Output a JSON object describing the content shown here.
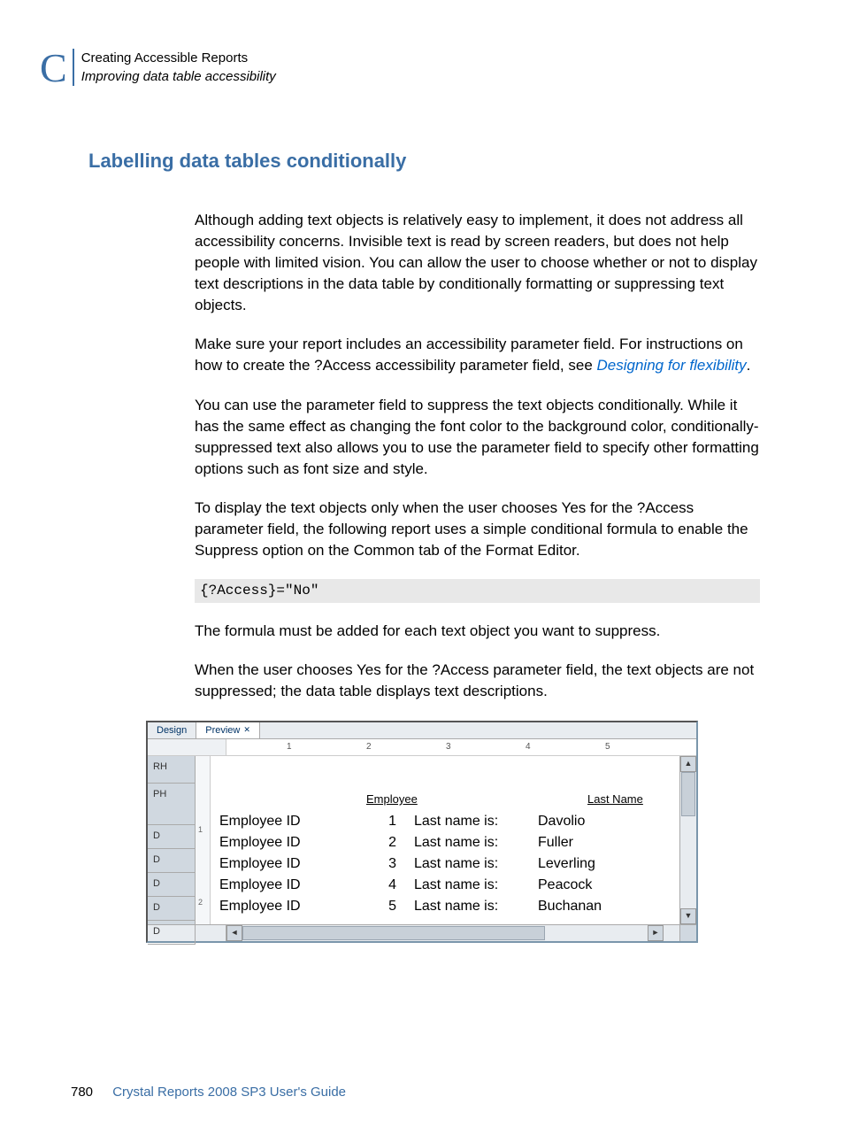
{
  "header": {
    "appendix_letter": "C",
    "line1": "Creating Accessible Reports",
    "line2": "Improving data table accessibility"
  },
  "section_heading": "Labelling data tables conditionally",
  "paragraphs": {
    "p1": "Although adding text objects is relatively easy to implement, it does not address all accessibility concerns. Invisible text is read by screen readers, but does not help people with limited vision. You can allow the user to choose whether or not to display text descriptions in the data table by conditionally formatting or suppressing text objects.",
    "p2a": "Make sure your report includes an accessibility parameter field. For instructions on how to create the ?Access accessibility parameter field, see ",
    "p2_link": "Designing for flexibility",
    "p2b": ".",
    "p3": "You can use the parameter field to suppress the text objects conditionally. While it has the same effect as changing the font color to the background color, conditionally-suppressed text also allows you to use the parameter field to specify other formatting options such as font size and style.",
    "p4": "To display the text objects only when the user chooses Yes for the ?Access parameter field, the following report uses a simple conditional formula to enable the Suppress option on the Common tab of the Format Editor.",
    "code": "{?Access}=\"No\"",
    "p5": "The formula must be added for each text object you want to suppress.",
    "p6": "When the user chooses Yes for the ?Access parameter field, the text objects are not suppressed; the data table displays text descriptions."
  },
  "screenshot": {
    "tabs": {
      "design": "Design",
      "preview": "Preview"
    },
    "ruler_nums": [
      "1",
      "2",
      "3",
      "4",
      "5"
    ],
    "sections": {
      "rh": "RH",
      "ph": "PH",
      "d": "D"
    },
    "vruler": {
      "one": "1",
      "two": "2"
    },
    "headers": {
      "employee": "Employee",
      "last_name": "Last Name"
    },
    "row_label_emp": "Employee ID",
    "row_label_ln": "Last name is:",
    "rows": [
      {
        "id": "1",
        "last_name": "Davolio"
      },
      {
        "id": "2",
        "last_name": "Fuller"
      },
      {
        "id": "3",
        "last_name": "Leverling"
      },
      {
        "id": "4",
        "last_name": "Peacock"
      },
      {
        "id": "5",
        "last_name": "Buchanan"
      }
    ]
  },
  "footer": {
    "page_number": "780",
    "doc_title": "Crystal Reports 2008 SP3 User's Guide"
  }
}
